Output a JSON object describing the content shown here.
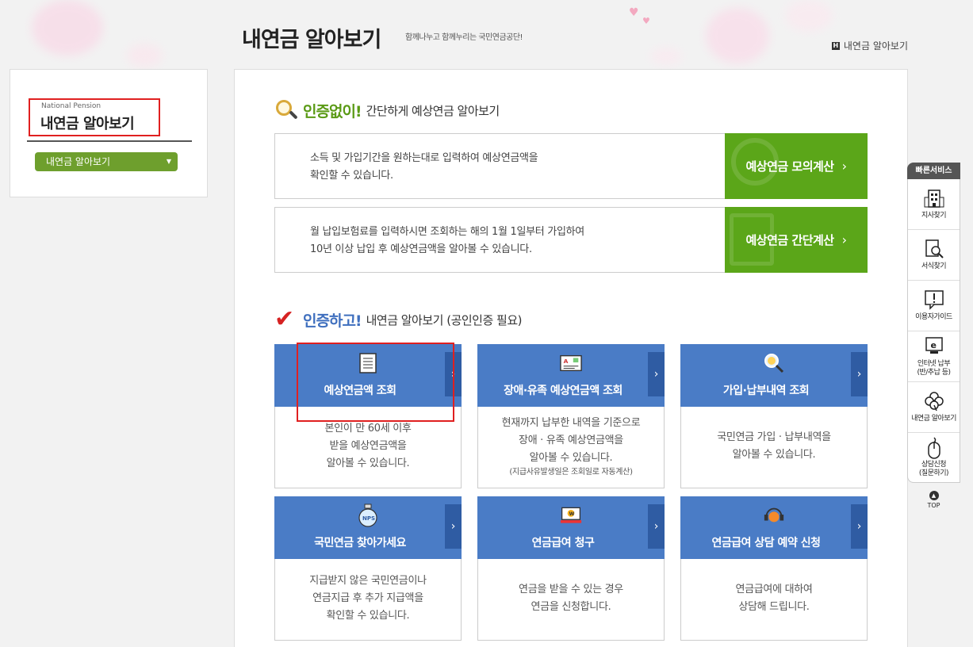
{
  "header": {
    "title": "내연금 알아보기",
    "slogan": "함께나누고 함께누리는 국민연금공단!",
    "breadcrumb": "내연금 알아보기"
  },
  "sidebar": {
    "eng_label": "National Pension",
    "title": "내연금 알아보기",
    "select_value": "내연금 알아보기"
  },
  "section_no_auth": {
    "accent": "인증없이!",
    "rest": "간단하게 예상연금 알아보기",
    "rows": [
      {
        "desc_line1": "소득 및 가입기간을 원하는대로 입력하여 예상연금액을",
        "desc_line2": "확인할 수 있습니다.",
        "button": "예상연금 모의계산"
      },
      {
        "desc_line1": "월 납입보험료를 입력하시면 조회하는 해의 1월 1일부터 가입하여",
        "desc_line2": "10년 이상 납입 후 예상연금액을 알아볼 수 있습니다.",
        "button": "예상연금 간단계산"
      }
    ]
  },
  "section_auth": {
    "accent": "인증하고!",
    "rest": "내연금 알아보기 (공인인증 필요)",
    "cards": [
      {
        "icon": "document-icon",
        "title": "예상연금액 조회",
        "lines": [
          "본인이 만 60세 이후",
          "받을 예상연금액을",
          "알아볼 수 있습니다."
        ],
        "note": ""
      },
      {
        "icon": "id-card-icon",
        "title": "장애·유족 예상연금액 조회",
        "lines": [
          "현재까지 납부한 내역을 기준으로",
          "장애 · 유족 예상연금액을",
          "알아볼 수 있습니다."
        ],
        "note": "(지급사유발생일은 조회일로 자동계산)"
      },
      {
        "icon": "magnifier-icon",
        "title": "가입·납부내역 조회",
        "lines": [
          "국민연금 가입 · 납부내역을",
          "알아볼 수 있습니다."
        ],
        "note": ""
      },
      {
        "icon": "nps-pouch-icon",
        "title": "국민연금 찾아가세요",
        "lines": [
          "지급받지 않은 국민연금이나",
          "연금지급 후 추가 지급액을",
          "확인할 수 있습니다."
        ],
        "note": ""
      },
      {
        "icon": "won-laptop-icon",
        "title": "연금급여 청구",
        "lines": [
          "연금을 받을 수 있는 경우",
          "연금을 신청합니다."
        ],
        "note": ""
      },
      {
        "icon": "headset-icon",
        "title": "연금급여 상담 예약 신청",
        "lines": [
          "연금급여에 대하여",
          "상담해 드립니다."
        ],
        "note": ""
      }
    ]
  },
  "quick_service": {
    "title": "빠른서비스",
    "items": [
      {
        "icon": "building-icon",
        "label": "지사찾기"
      },
      {
        "icon": "form-search-icon",
        "label": "서식찾기"
      },
      {
        "icon": "exclamation-bubble-icon",
        "label": "이용자가이드"
      },
      {
        "icon": "internet-payment-icon",
        "label": "인터넷 납부",
        "label2": "(반/추납 등)"
      },
      {
        "icon": "clover-icon",
        "label": "내연금 알아보기"
      },
      {
        "icon": "mouse-icon",
        "label": "상담신청",
        "label2": "(질문하기)"
      }
    ],
    "top_label": "TOP"
  },
  "colors": {
    "green_accent": "#5ba619",
    "blue_card": "#4a7cc6",
    "blue_arrow": "#2f5ca3",
    "select_green": "#6e9f2d",
    "highlight_red": "#e02020"
  }
}
